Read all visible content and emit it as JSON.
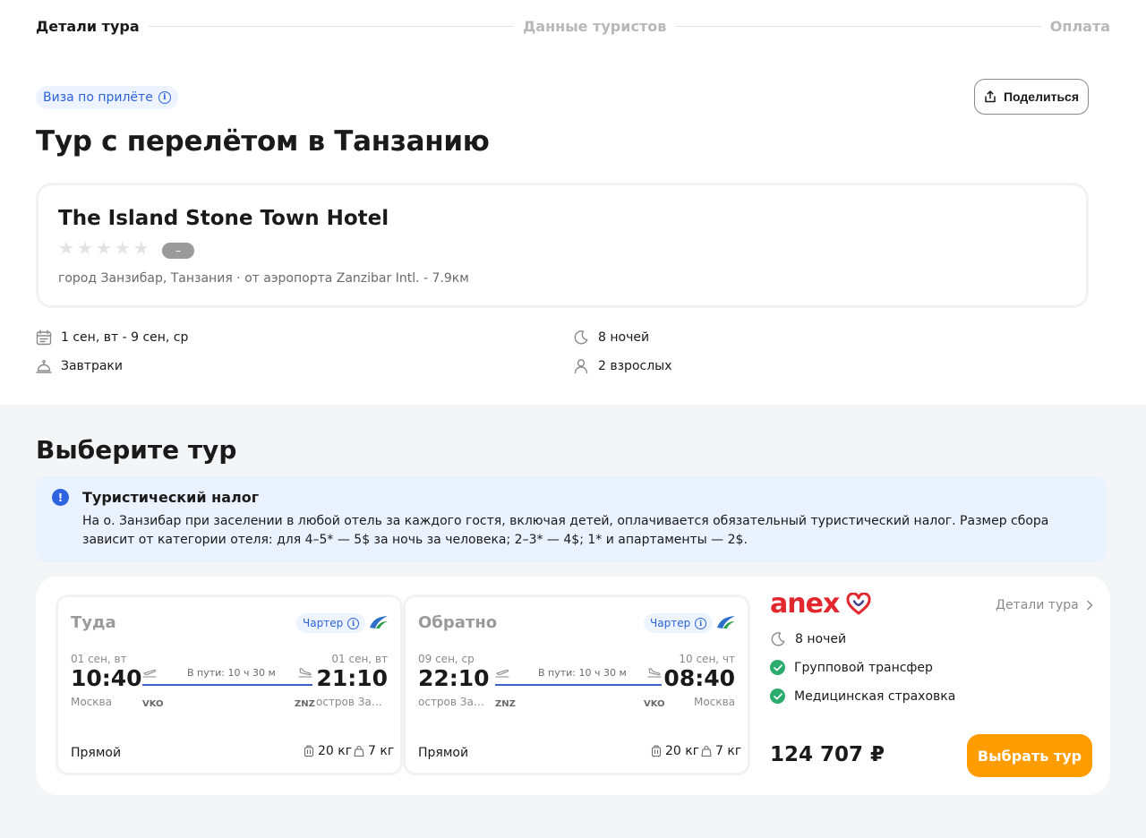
{
  "steps": [
    "Детали тура",
    "Данные туристов",
    "Оплата"
  ],
  "visa_badge": "Виза по прилёте",
  "share_label": "Поделиться",
  "title": "Тур с перелётом в Танзанию",
  "hotel": {
    "name": "The Island Stone Town Hotel",
    "rating": "–",
    "location": "город Занзибар, Танзания · от аэропорта Zanzibar Intl. - 7.9км"
  },
  "meta": {
    "dates": "1 сен, вт - 9 сен, ср",
    "nights": "8 ночей",
    "meals": "Завтраки",
    "guests": "2 взрослых"
  },
  "section_title": "Выберите тур",
  "tax": {
    "title": "Туристический налог",
    "text": "На о. Занзибар при заселении в любой отель за каждого гостя, включая детей, оплачивается обязательный туристический налог. Размер сбора зависит от категории отеля: для 4–5* — 5$ за ночь за человека; 2–3* — 4$; 1* и апартаменты — 2$."
  },
  "flights": [
    {
      "direction": "Туда",
      "charter": "Чартер",
      "dep_date": "01 сен, вт",
      "dep_time": "10:40",
      "dep_city": "Москва",
      "dep_code": "VKO",
      "arr_date": "01 сен, вт",
      "arr_time": "21:10",
      "arr_city": "остров Занзибар",
      "arr_code": "ZNZ",
      "duration": "В пути: 10 ч 30 м",
      "type": "Прямой",
      "baggage": "20 кг",
      "hand": "7 кг"
    },
    {
      "direction": "Обратно",
      "charter": "Чартер",
      "dep_date": "09 сен, ср",
      "dep_time": "22:10",
      "dep_city": "остров Занзибар",
      "dep_code": "ZNZ",
      "arr_date": "10 сен, чт",
      "arr_time": "08:40",
      "arr_city": "Москва",
      "arr_code": "VKO",
      "duration": "В пути: 10 ч 30 м",
      "type": "Прямой",
      "baggage": "20 кг",
      "hand": "7 кг"
    }
  ],
  "operator": {
    "logo_text": "anex",
    "details_link": "Детали тура",
    "nights": "8 ночей",
    "features": [
      "Групповой трансфер",
      "Медицинская страховка"
    ],
    "price": "124 707 ₽",
    "choose_label": "Выбрать тур"
  },
  "colors": {
    "accent_orange": "#ff9d00",
    "link_blue": "#2c63d6",
    "route_blue": "#3b63c9",
    "anex_red": "#e2272f",
    "check_green": "#2bab6e",
    "section_bg": "#f4f5f7",
    "tax_bg": "#eaf2ff"
  }
}
